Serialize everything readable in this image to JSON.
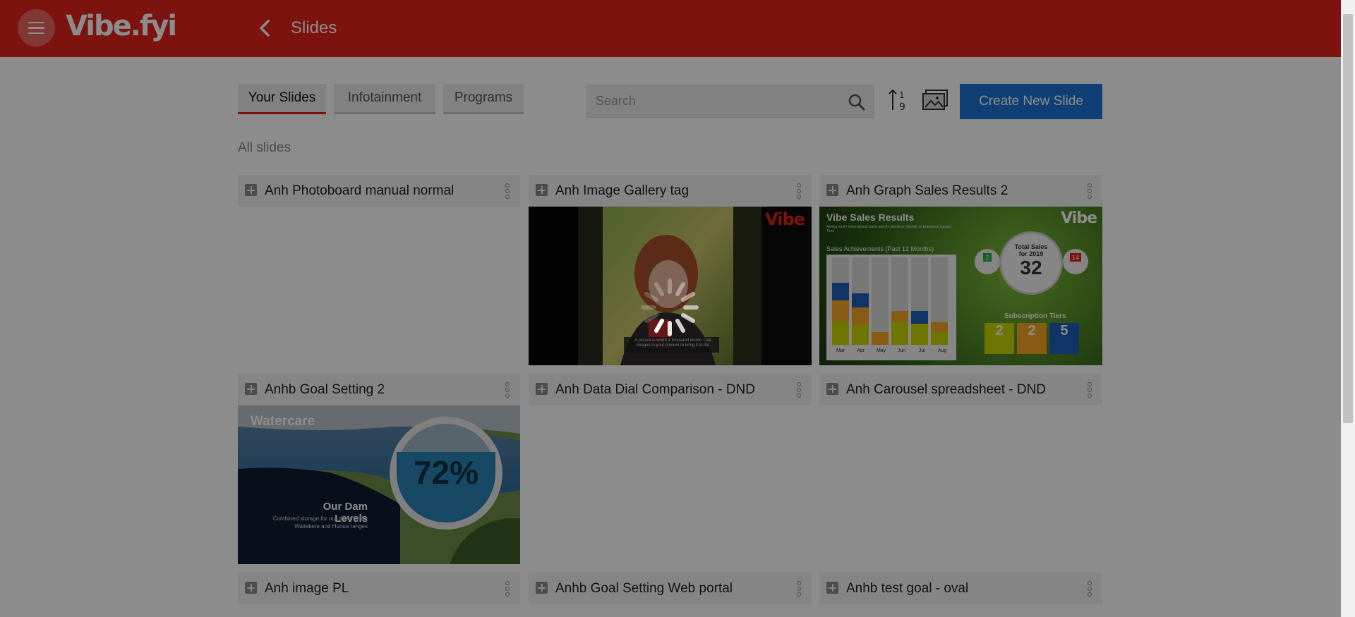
{
  "header": {
    "logo": "Vibe.fyi",
    "title": "Slides"
  },
  "tabs": [
    {
      "label": "Your Slides",
      "active": true
    },
    {
      "label": "Infotainment",
      "active": false
    },
    {
      "label": "Programs",
      "active": false
    }
  ],
  "search": {
    "placeholder": "Search",
    "value": ""
  },
  "toolbar": {
    "create_label": "Create New Slide"
  },
  "section_label": "All slides",
  "slides": [
    {
      "title": "Anh Photoboard manual normal",
      "thumbnail": "none"
    },
    {
      "title": "Anh Image Gallery tag",
      "thumbnail": "image-gallery"
    },
    {
      "title": "Anh Graph Sales Results 2",
      "thumbnail": "sales-results"
    },
    {
      "title": "Anhb Goal Setting 2",
      "thumbnail": "dam-levels"
    },
    {
      "title": "Anh Data Dial Comparison - DND",
      "thumbnail": "none"
    },
    {
      "title": "Anh Carousel spreadsheet - DND",
      "thumbnail": "none"
    },
    {
      "title": "Anh image PL",
      "thumbnail": "none"
    },
    {
      "title": "Anhb Goal Setting Web portal",
      "thumbnail": "none"
    },
    {
      "title": "Anhb test goal - oval",
      "thumbnail": "none"
    }
  ],
  "thumb_gallery": {
    "brand": "Vibe",
    "caption": "A picture is worth a thousand words. Use images in your content to bring it to life"
  },
  "thumb_sales": {
    "title": "Vibe Sales Results",
    "subtitle": "Aiming for 8+ International Sales and 8+ clients on Growth or Enterprise support Tiers",
    "brand": "Vibe",
    "chart_title": "Sales Achievements (Past 12 Months)",
    "months": [
      "Mar",
      "Apr",
      "May",
      "Jun",
      "Jul",
      "Aug"
    ],
    "total_label_1": "Total Sales",
    "total_label_2": "for 2019",
    "total_value": "32",
    "left_badge": "2",
    "right_badge": "14",
    "tiers_title": "Subscription Tiers",
    "tiers": [
      "2",
      "2",
      "5"
    ]
  },
  "thumb_dam": {
    "brand": "Watercare",
    "percent": "72%",
    "heading": "Our Dam Levels",
    "subtext_1": "Combined storage for our dams in the",
    "subtext_2": "Waitakere and Hunua ranges"
  },
  "colors": {
    "brand_red": "#e2231a",
    "primary_blue": "#1c73d6",
    "overlay": "rgba(0,0,0,0.45)"
  },
  "status": {
    "loading": true
  }
}
